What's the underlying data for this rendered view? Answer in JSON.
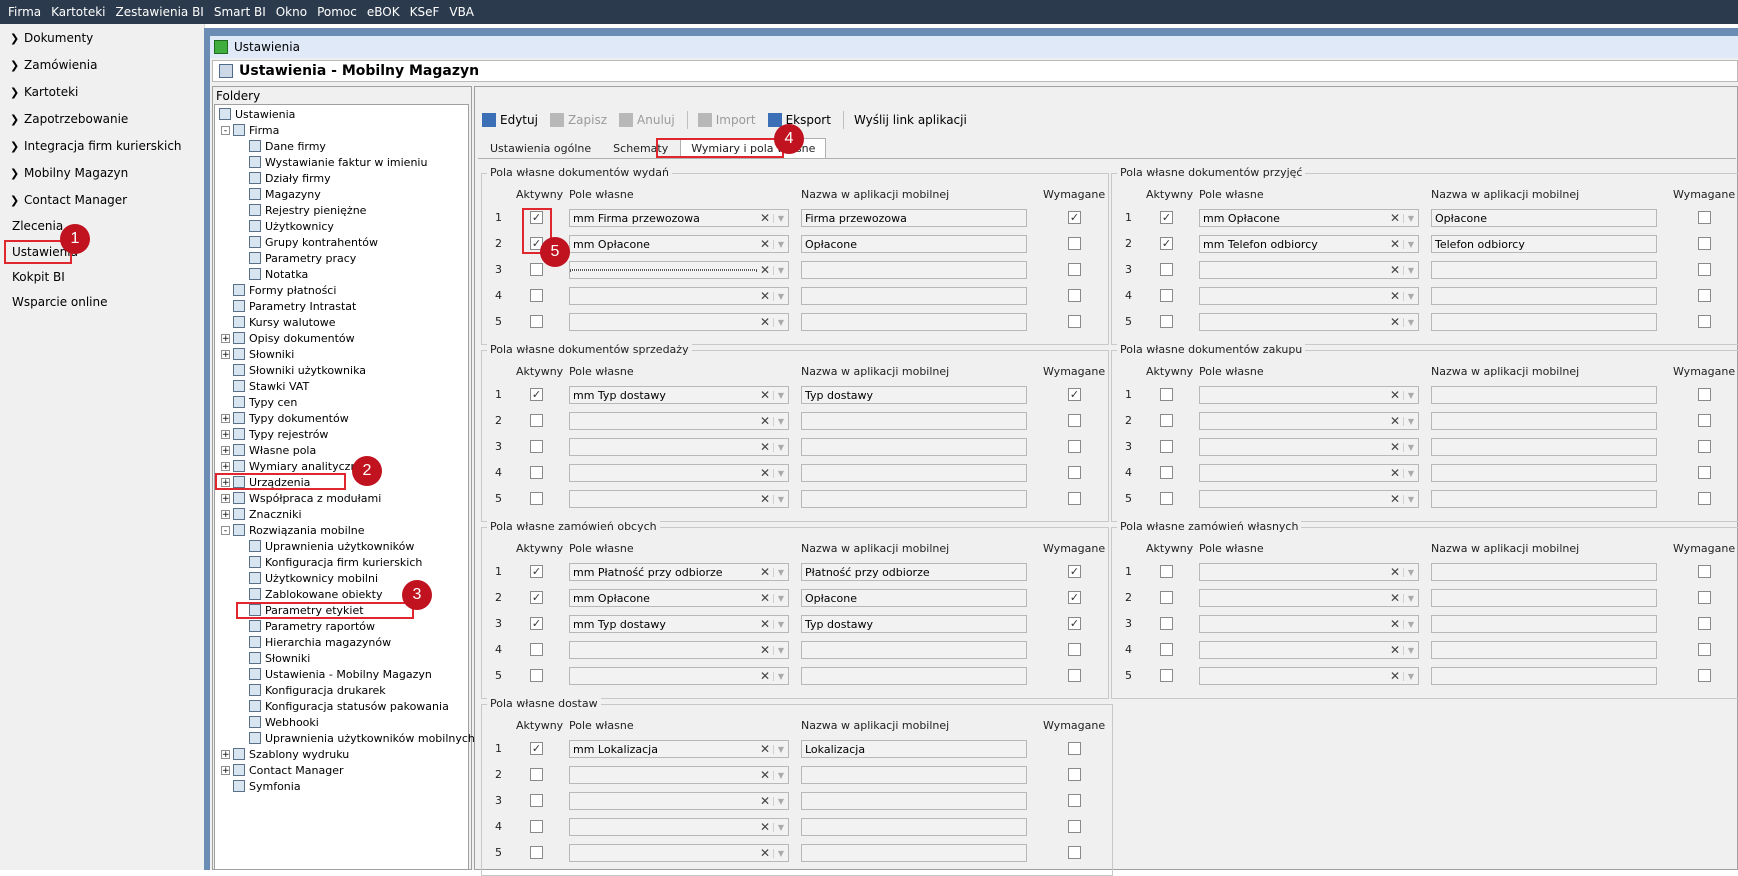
{
  "menubar": [
    "Firma",
    "Kartoteki",
    "Zestawienia BI",
    "Smart BI",
    "Okno",
    "Pomoc",
    "eBOK",
    "KSeF",
    "VBA"
  ],
  "nav": {
    "expandable": [
      "Dokumenty",
      "Zamówienia",
      "Kartoteki",
      "Zapotrzebowanie",
      "Integracja firm kurierskich",
      "Mobilny Magazyn",
      "Contact Manager"
    ],
    "plain": [
      "Zlecenia",
      "Ustawienia",
      "Kokpit BI",
      "Wsparcie online"
    ]
  },
  "badges": [
    "1",
    "2",
    "3",
    "4",
    "5"
  ],
  "window": {
    "title": "Ustawienia",
    "header": "Ustawienia - Mobilny Magazyn",
    "folders_label": "Foldery"
  },
  "tree": [
    {
      "label": "Ustawienia",
      "level": 0,
      "toggle": ""
    },
    {
      "label": "Firma",
      "level": 1,
      "toggle": "-"
    },
    {
      "label": "Dane firmy",
      "level": 2,
      "toggle": ""
    },
    {
      "label": "Wystawianie faktur w imieniu",
      "level": 2,
      "toggle": ""
    },
    {
      "label": "Działy firmy",
      "level": 2,
      "toggle": ""
    },
    {
      "label": "Magazyny",
      "level": 2,
      "toggle": ""
    },
    {
      "label": "Rejestry pieniężne",
      "level": 2,
      "toggle": ""
    },
    {
      "label": "Użytkownicy",
      "level": 2,
      "toggle": ""
    },
    {
      "label": "Grupy kontrahentów",
      "level": 2,
      "toggle": ""
    },
    {
      "label": "Parametry pracy",
      "level": 2,
      "toggle": ""
    },
    {
      "label": "Notatka",
      "level": 2,
      "toggle": ""
    },
    {
      "label": "Formy płatności",
      "level": 1,
      "toggle": ""
    },
    {
      "label": "Parametry Intrastat",
      "level": 1,
      "toggle": ""
    },
    {
      "label": "Kursy walutowe",
      "level": 1,
      "toggle": ""
    },
    {
      "label": "Opisy dokumentów",
      "level": 1,
      "toggle": "+"
    },
    {
      "label": "Słowniki",
      "level": 1,
      "toggle": "+"
    },
    {
      "label": "Słowniki użytkownika",
      "level": 1,
      "toggle": ""
    },
    {
      "label": "Stawki VAT",
      "level": 1,
      "toggle": ""
    },
    {
      "label": "Typy cen",
      "level": 1,
      "toggle": ""
    },
    {
      "label": "Typy dokumentów",
      "level": 1,
      "toggle": "+"
    },
    {
      "label": "Typy rejestrów",
      "level": 1,
      "toggle": "+"
    },
    {
      "label": "Własne pola",
      "level": 1,
      "toggle": "+"
    },
    {
      "label": "Wymiary analityczne",
      "level": 1,
      "toggle": "+"
    },
    {
      "label": "Urządzenia",
      "level": 1,
      "toggle": "+"
    },
    {
      "label": "Współpraca z modułami",
      "level": 1,
      "toggle": "+"
    },
    {
      "label": "Znaczniki",
      "level": 1,
      "toggle": "+"
    },
    {
      "label": "Rozwiązania mobilne",
      "level": 1,
      "toggle": "-"
    },
    {
      "label": "Uprawnienia użytkowników",
      "level": 2,
      "toggle": ""
    },
    {
      "label": "Konfiguracja firm kurierskich",
      "level": 2,
      "toggle": ""
    },
    {
      "label": "Użytkownicy mobilni",
      "level": 2,
      "toggle": ""
    },
    {
      "label": "Zablokowane obiekty",
      "level": 2,
      "toggle": ""
    },
    {
      "label": "Parametry etykiet",
      "level": 2,
      "toggle": ""
    },
    {
      "label": "Parametry raportów",
      "level": 2,
      "toggle": ""
    },
    {
      "label": "Hierarchia magazynów",
      "level": 2,
      "toggle": ""
    },
    {
      "label": "Słowniki",
      "level": 2,
      "toggle": ""
    },
    {
      "label": "Ustawienia - Mobilny Magazyn",
      "level": 2,
      "toggle": ""
    },
    {
      "label": "Konfiguracja drukarek",
      "level": 2,
      "toggle": ""
    },
    {
      "label": "Konfiguracja statusów pakowania",
      "level": 2,
      "toggle": ""
    },
    {
      "label": "Webhooki",
      "level": 2,
      "toggle": ""
    },
    {
      "label": "Uprawnienia użytkowników mobilnych",
      "level": 2,
      "toggle": ""
    },
    {
      "label": "Szablony wydruku",
      "level": 1,
      "toggle": "+"
    },
    {
      "label": "Contact Manager",
      "level": 1,
      "toggle": "+"
    },
    {
      "label": "Symfonia",
      "level": 1,
      "toggle": ""
    }
  ],
  "toolbar": [
    {
      "label": "Edytuj",
      "enabled": true,
      "icon": "edit-icon"
    },
    {
      "label": "Zapisz",
      "enabled": false,
      "icon": "save-icon"
    },
    {
      "label": "Anuluj",
      "enabled": false,
      "icon": "undo-icon"
    },
    {
      "label": "Import",
      "enabled": false,
      "icon": "folder-icon"
    },
    {
      "label": "Eksport",
      "enabled": true,
      "icon": "folder-export-icon"
    },
    {
      "label": "Wyślij link aplikacji",
      "enabled": true,
      "icon": ""
    }
  ],
  "tabs": [
    "Ustawienia ogólne",
    "Schematy",
    "Wymiary i pola własne"
  ],
  "active_tab": 2,
  "headers": {
    "aktywny": "Aktywny",
    "pole": "Pole własne",
    "nazwa": "Nazwa w aplikacji mobilnej",
    "wymagane": "Wymagane"
  },
  "groups": [
    {
      "title": "Pola własne dokumentów wydań",
      "rows": [
        {
          "n": "1",
          "active": true,
          "field": "mm Firma przewozowa",
          "name": "Firma przewozowa",
          "required": true
        },
        {
          "n": "2",
          "active": true,
          "field": "mm Opłacone",
          "name": "Opłacone",
          "required": false
        },
        {
          "n": "3",
          "active": false,
          "field": "",
          "name": "",
          "required": false
        },
        {
          "n": "4",
          "active": false,
          "field": "",
          "name": "",
          "required": false
        },
        {
          "n": "5",
          "active": false,
          "field": "",
          "name": "",
          "required": false
        }
      ]
    },
    {
      "title": "Pola własne dokumentów przyjęć",
      "rows": [
        {
          "n": "1",
          "active": true,
          "field": "mm Opłacone",
          "name": "Opłacone",
          "required": false
        },
        {
          "n": "2",
          "active": true,
          "field": "mm Telefon odbiorcy",
          "name": "Telefon odbiorcy",
          "required": false
        },
        {
          "n": "3",
          "active": false,
          "field": "",
          "name": "",
          "required": false
        },
        {
          "n": "4",
          "active": false,
          "field": "",
          "name": "",
          "required": false
        },
        {
          "n": "5",
          "active": false,
          "field": "",
          "name": "",
          "required": false
        }
      ]
    },
    {
      "title": "Pola własne dokumentów sprzedaży",
      "rows": [
        {
          "n": "1",
          "active": true,
          "field": "mm Typ dostawy",
          "name": "Typ dostawy",
          "required": true
        },
        {
          "n": "2",
          "active": false,
          "field": "",
          "name": "",
          "required": false
        },
        {
          "n": "3",
          "active": false,
          "field": "",
          "name": "",
          "required": false
        },
        {
          "n": "4",
          "active": false,
          "field": "",
          "name": "",
          "required": false
        },
        {
          "n": "5",
          "active": false,
          "field": "",
          "name": "",
          "required": false
        }
      ]
    },
    {
      "title": "Pola własne dokumentów zakupu",
      "rows": [
        {
          "n": "1",
          "active": false,
          "field": "",
          "name": "",
          "required": false
        },
        {
          "n": "2",
          "active": false,
          "field": "",
          "name": "",
          "required": false
        },
        {
          "n": "3",
          "active": false,
          "field": "",
          "name": "",
          "required": false
        },
        {
          "n": "4",
          "active": false,
          "field": "",
          "name": "",
          "required": false
        },
        {
          "n": "5",
          "active": false,
          "field": "",
          "name": "",
          "required": false
        }
      ]
    },
    {
      "title": "Pola własne zamówień obcych",
      "rows": [
        {
          "n": "1",
          "active": true,
          "field": "mm Płatność przy odbiorze",
          "name": "Płatność przy odbiorze",
          "required": true
        },
        {
          "n": "2",
          "active": true,
          "field": "mm Opłacone",
          "name": "Opłacone",
          "required": true
        },
        {
          "n": "3",
          "active": true,
          "field": "mm Typ dostawy",
          "name": "Typ dostawy",
          "required": true
        },
        {
          "n": "4",
          "active": false,
          "field": "",
          "name": "",
          "required": false
        },
        {
          "n": "5",
          "active": false,
          "field": "",
          "name": "",
          "required": false
        }
      ]
    },
    {
      "title": "Pola własne zamówień własnych",
      "rows": [
        {
          "n": "1",
          "active": false,
          "field": "",
          "name": "",
          "required": false
        },
        {
          "n": "2",
          "active": false,
          "field": "",
          "name": "",
          "required": false
        },
        {
          "n": "3",
          "active": false,
          "field": "",
          "name": "",
          "required": false
        },
        {
          "n": "4",
          "active": false,
          "field": "",
          "name": "",
          "required": false
        },
        {
          "n": "5",
          "active": false,
          "field": "",
          "name": "",
          "required": false
        }
      ]
    },
    {
      "title": "Pola własne dostaw",
      "rows": [
        {
          "n": "1",
          "active": true,
          "field": "mm Lokalizacja",
          "name": "Lokalizacja",
          "required": false
        },
        {
          "n": "2",
          "active": false,
          "field": "",
          "name": "",
          "required": false
        },
        {
          "n": "3",
          "active": false,
          "field": "",
          "name": "",
          "required": false
        },
        {
          "n": "4",
          "active": false,
          "field": "",
          "name": "",
          "required": false
        },
        {
          "n": "5",
          "active": false,
          "field": "",
          "name": "",
          "required": false
        }
      ]
    }
  ],
  "colors": {
    "menubar": "#2b3a4c",
    "window_frame": "#6b8db5",
    "highlight": "#e0262f",
    "badge": "#c0131f"
  }
}
